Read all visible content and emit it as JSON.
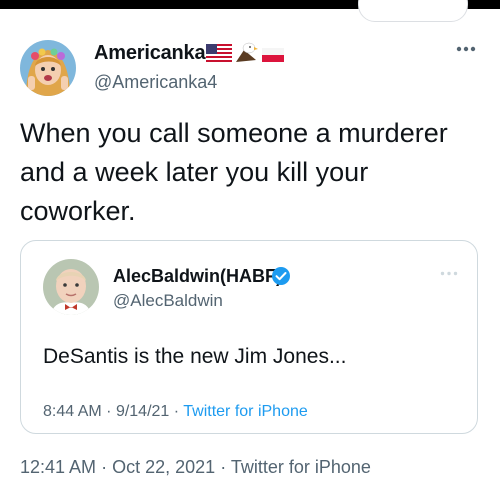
{
  "tweet": {
    "author_name": "Americanka",
    "author_handle": "@Americanka4",
    "name_emojis": [
      "us-flag-emoji",
      "eagle-emoji",
      "poland-flag-emoji"
    ],
    "text": "When you call someone a murderer and a week later you kill your coworker.",
    "time": "12:41 AM",
    "date": "Oct 22, 2021",
    "source": "Twitter for iPhone",
    "separator": "·"
  },
  "quoted": {
    "author_name": "AlecBaldwin(HABF)",
    "author_handle": "@AlecBaldwin",
    "verified": true,
    "text": "DeSantis is the new Jim Jones...",
    "time": "8:44 AM",
    "date": "9/14/21",
    "source": "Twitter for iPhone",
    "separator": "·"
  },
  "colors": {
    "accent": "#1d9bf0",
    "secondary_text": "#536471",
    "border": "#cfd9de",
    "primary_text": "#0f1419"
  }
}
